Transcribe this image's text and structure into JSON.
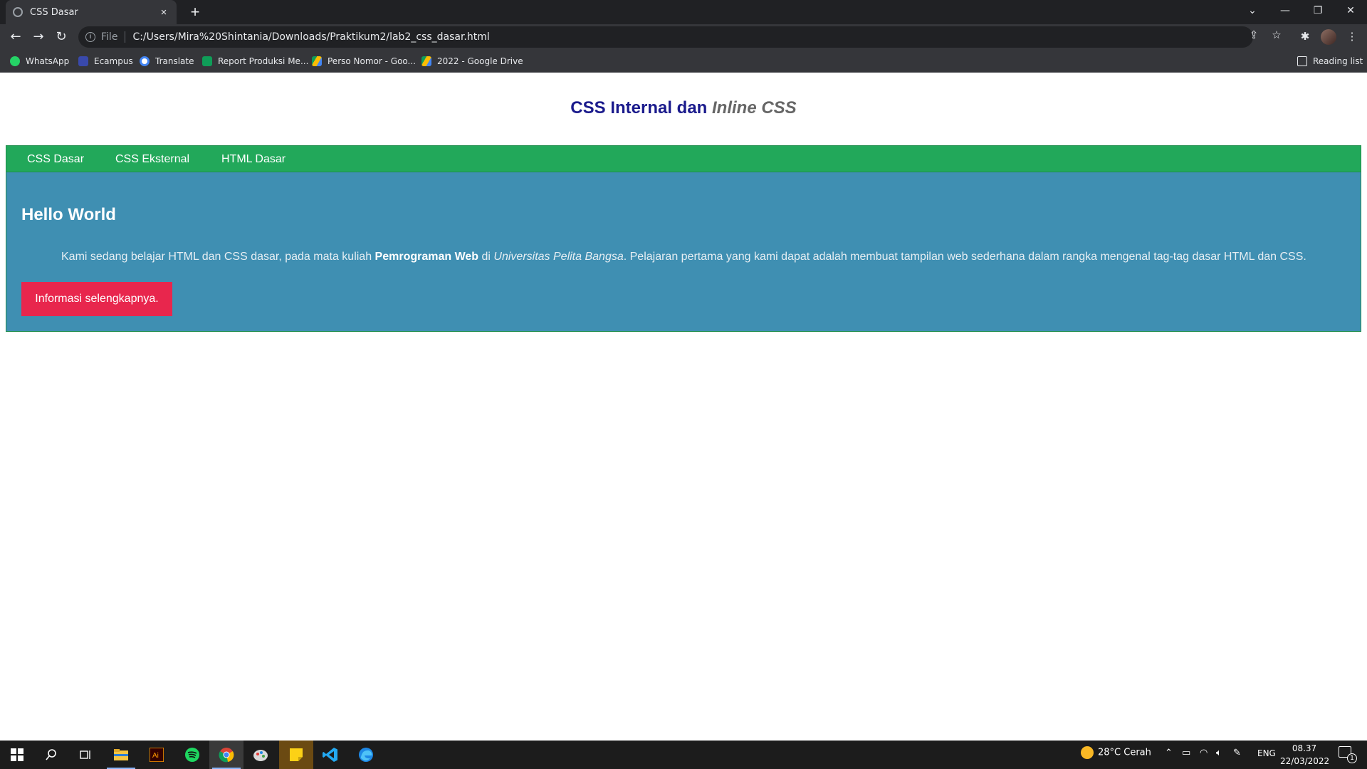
{
  "browser": {
    "tab_title": "CSS Dasar",
    "tab_close": "×",
    "new_tab": "+",
    "url_scheme": "File",
    "url": "C:/Users/Mira%20Shintania/Downloads/Praktikum2/lab2_css_dasar.html",
    "bookmarks": [
      {
        "label": "WhatsApp",
        "color": "#25d366"
      },
      {
        "label": "Ecampus",
        "color": "#3949ab"
      },
      {
        "label": "Translate",
        "color": "#ffffff"
      },
      {
        "label": "Report Produksi Me...",
        "color": "#0f9d58"
      },
      {
        "label": "Perso Nomor - Goo...",
        "color": "#fbbc04"
      },
      {
        "label": "2022 - Google Drive",
        "color": "#fbbc04"
      }
    ],
    "reading_list": "Reading list"
  },
  "page": {
    "title_normal": "CSS Internal dan ",
    "title_italic": "Inline CSS",
    "nav": [
      "CSS Dasar",
      "CSS Eksternal",
      "HTML Dasar"
    ],
    "heading": "Hello World",
    "paragraph": {
      "part1": "Kami sedang belajar HTML dan CSS dasar, pada mata kuliah ",
      "bold": "Pemrograman Web",
      "part2": " di ",
      "italic": "Universitas Pelita Bangsa",
      "part3": ". Pelajaran pertama yang kami dapat adalah membuat tampilan web sederhana dalam rangka mengenal tag-tag dasar HTML dan CSS."
    },
    "button": "Informasi selengkapnya."
  },
  "taskbar": {
    "weather": "28°C  Cerah",
    "language": "ENG",
    "time": "08.37",
    "date": "22/03/2022",
    "notification_count": "1"
  },
  "colors": {
    "navbar": "#22a85a",
    "content": "#3f8fb2",
    "button": "#e8264d",
    "title": "#1a1a8c"
  }
}
